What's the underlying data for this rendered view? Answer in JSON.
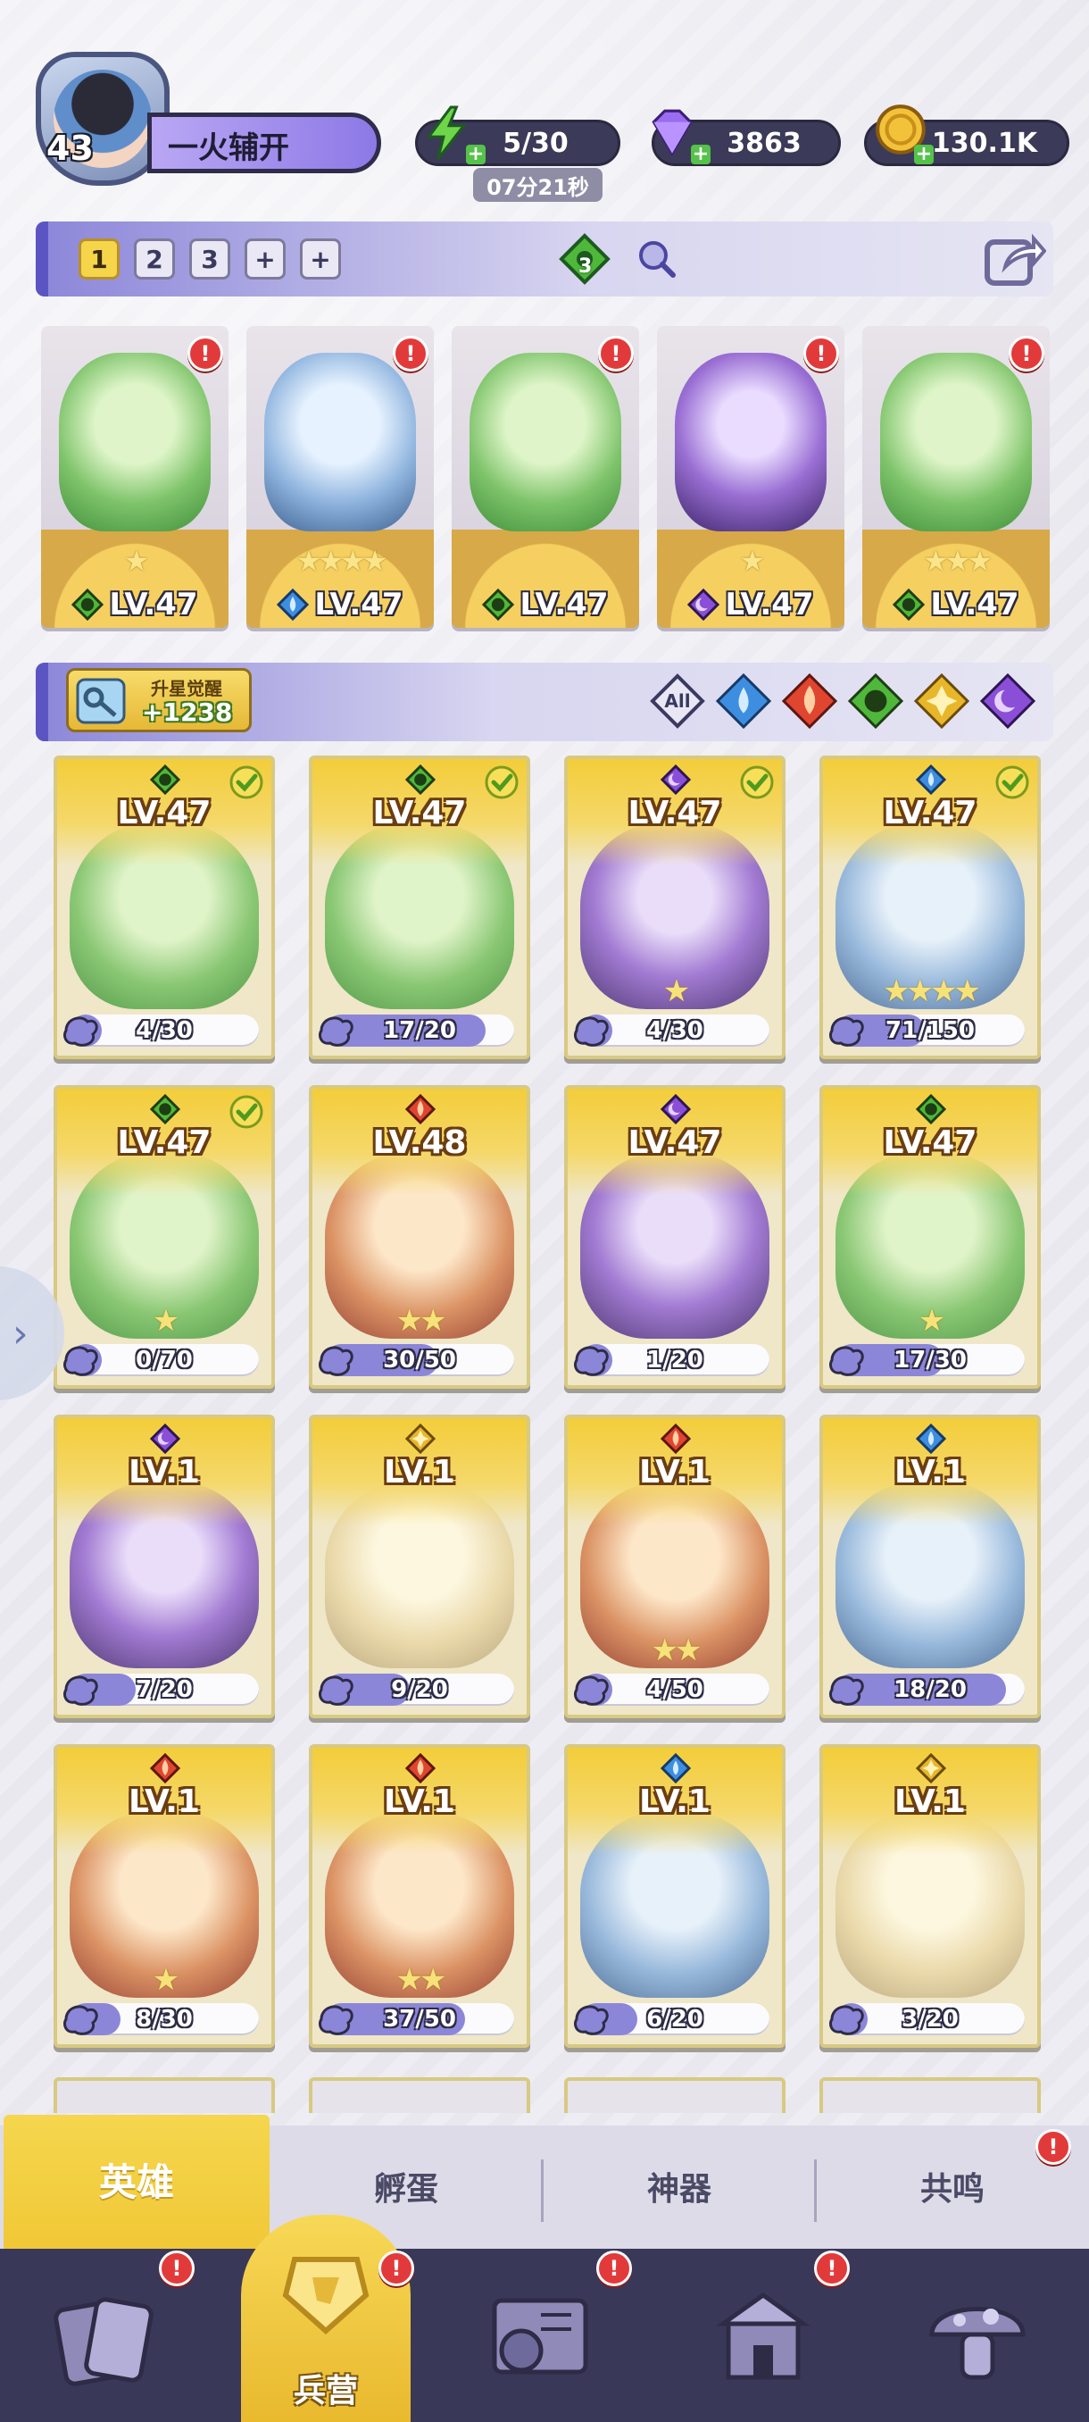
{
  "player": {
    "level": "43",
    "name": "一火辅开"
  },
  "resources": {
    "energy": "5/30",
    "energy_timer": "07分21秒",
    "gems": "3863",
    "coins": "130.1K"
  },
  "team": {
    "slots": [
      "1",
      "2",
      "3",
      "+",
      "+"
    ],
    "active_slot": 0,
    "element_count": "3",
    "heroes": [
      {
        "level": "LV.47",
        "element": "nature",
        "stars": 1,
        "alert": "!"
      },
      {
        "level": "LV.47",
        "element": "water",
        "stars": 4,
        "alert": "!"
      },
      {
        "level": "LV.47",
        "element": "nature",
        "stars": 0,
        "alert": "!"
      },
      {
        "level": "LV.47",
        "element": "dark",
        "stars": 1,
        "alert": "!"
      },
      {
        "level": "LV.47",
        "element": "nature",
        "stars": 3,
        "alert": "!"
      }
    ]
  },
  "filters": {
    "star_awaken_label": "升星觉醒",
    "star_awaken_value": "+1238",
    "all_label": "All",
    "elements": [
      "water",
      "fire",
      "nature",
      "light",
      "dark"
    ]
  },
  "heroes": [
    {
      "level": "LV.47",
      "element": "nature",
      "fragments": "4/30",
      "progress": 0.13,
      "owned": true,
      "stars": 0
    },
    {
      "level": "LV.47",
      "element": "nature",
      "fragments": "17/20",
      "progress": 0.85,
      "owned": true,
      "stars": 0
    },
    {
      "level": "LV.47",
      "element": "dark",
      "fragments": "4/30",
      "progress": 0.13,
      "owned": true,
      "stars": 1
    },
    {
      "level": "LV.47",
      "element": "water",
      "fragments": "71/150",
      "progress": 0.47,
      "owned": true,
      "stars": 4
    },
    {
      "level": "LV.47",
      "element": "nature",
      "fragments": "0/70",
      "progress": 0.0,
      "owned": true,
      "stars": 1
    },
    {
      "level": "LV.48",
      "element": "fire",
      "fragments": "30/50",
      "progress": 0.6,
      "owned": false,
      "stars": 2
    },
    {
      "level": "LV.47",
      "element": "dark",
      "fragments": "1/20",
      "progress": 0.05,
      "owned": false,
      "stars": 0
    },
    {
      "level": "LV.47",
      "element": "nature",
      "fragments": "17/30",
      "progress": 0.57,
      "owned": false,
      "stars": 1
    },
    {
      "level": "LV.1",
      "element": "dark",
      "fragments": "7/20",
      "progress": 0.35,
      "owned": false,
      "stars": 0
    },
    {
      "level": "LV.1",
      "element": "light",
      "fragments": "9/20",
      "progress": 0.45,
      "owned": false,
      "stars": 0
    },
    {
      "level": "LV.1",
      "element": "fire",
      "fragments": "4/50",
      "progress": 0.08,
      "owned": false,
      "stars": 2
    },
    {
      "level": "LV.1",
      "element": "water",
      "fragments": "18/20",
      "progress": 0.9,
      "owned": false,
      "stars": 0
    },
    {
      "level": "LV.1",
      "element": "fire",
      "fragments": "8/30",
      "progress": 0.27,
      "owned": false,
      "stars": 1
    },
    {
      "level": "LV.1",
      "element": "fire",
      "fragments": "37/50",
      "progress": 0.74,
      "owned": false,
      "stars": 2
    },
    {
      "level": "LV.1",
      "element": "water",
      "fragments": "6/20",
      "progress": 0.3,
      "owned": false,
      "stars": 0
    },
    {
      "level": "LV.1",
      "element": "light",
      "fragments": "3/20",
      "progress": 0.15,
      "owned": false,
      "stars": 0
    }
  ],
  "sub_tabs": [
    {
      "label": "英雄",
      "active": true
    },
    {
      "label": "孵蛋",
      "active": false
    },
    {
      "label": "神器",
      "active": false
    },
    {
      "label": "共鸣",
      "active": false,
      "alert": "!"
    }
  ],
  "bottom_nav": [
    {
      "name": "cards",
      "label": "",
      "alert": "!"
    },
    {
      "name": "barracks",
      "label": "兵营",
      "alert": "!"
    },
    {
      "name": "map",
      "label": "",
      "alert": "!"
    },
    {
      "name": "temple",
      "label": "",
      "alert": "!"
    },
    {
      "name": "mushroom",
      "label": "",
      "alert": ""
    }
  ],
  "colors": {
    "nature": "#4fb83a",
    "water": "#3d8ee0",
    "fire": "#e0452f",
    "light": "#e8b62a",
    "dark": "#8a4fd6",
    "accent": "#f3cd3a",
    "nav": "#3a3858"
  }
}
